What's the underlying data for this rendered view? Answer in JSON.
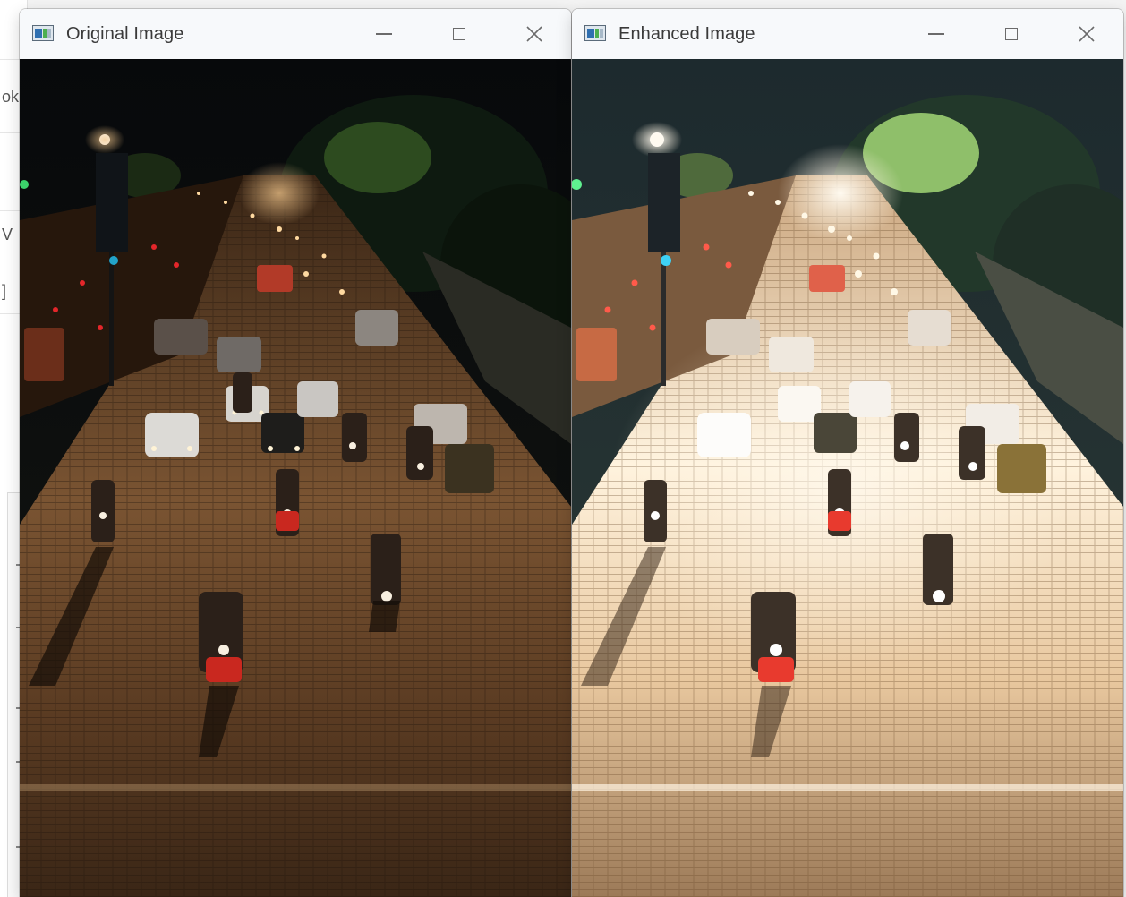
{
  "windows": [
    {
      "id": "original",
      "title": "Original Image",
      "controls": {
        "minimize": "minimize-icon",
        "maximize": "maximize-icon",
        "close": "close-icon"
      },
      "image": {
        "subject": "night street traffic with motorbikes",
        "tone": "dark"
      }
    },
    {
      "id": "enhanced",
      "title": "Enhanced Image",
      "controls": {
        "minimize": "minimize-icon",
        "maximize": "maximize-icon",
        "close": "close-icon"
      },
      "image": {
        "subject": "night street traffic with motorbikes",
        "tone": "brightened"
      }
    }
  ],
  "colors": {
    "titlebar_bg": "#f7f9fb",
    "title_text": "#3a3a3a",
    "control_icon": "#6b6b6b",
    "app_icon_blue": "#2f6fb0",
    "app_icon_green": "#4caf50"
  },
  "background_app": {
    "glyphs": [
      "ok",
      "V",
      "]"
    ]
  }
}
